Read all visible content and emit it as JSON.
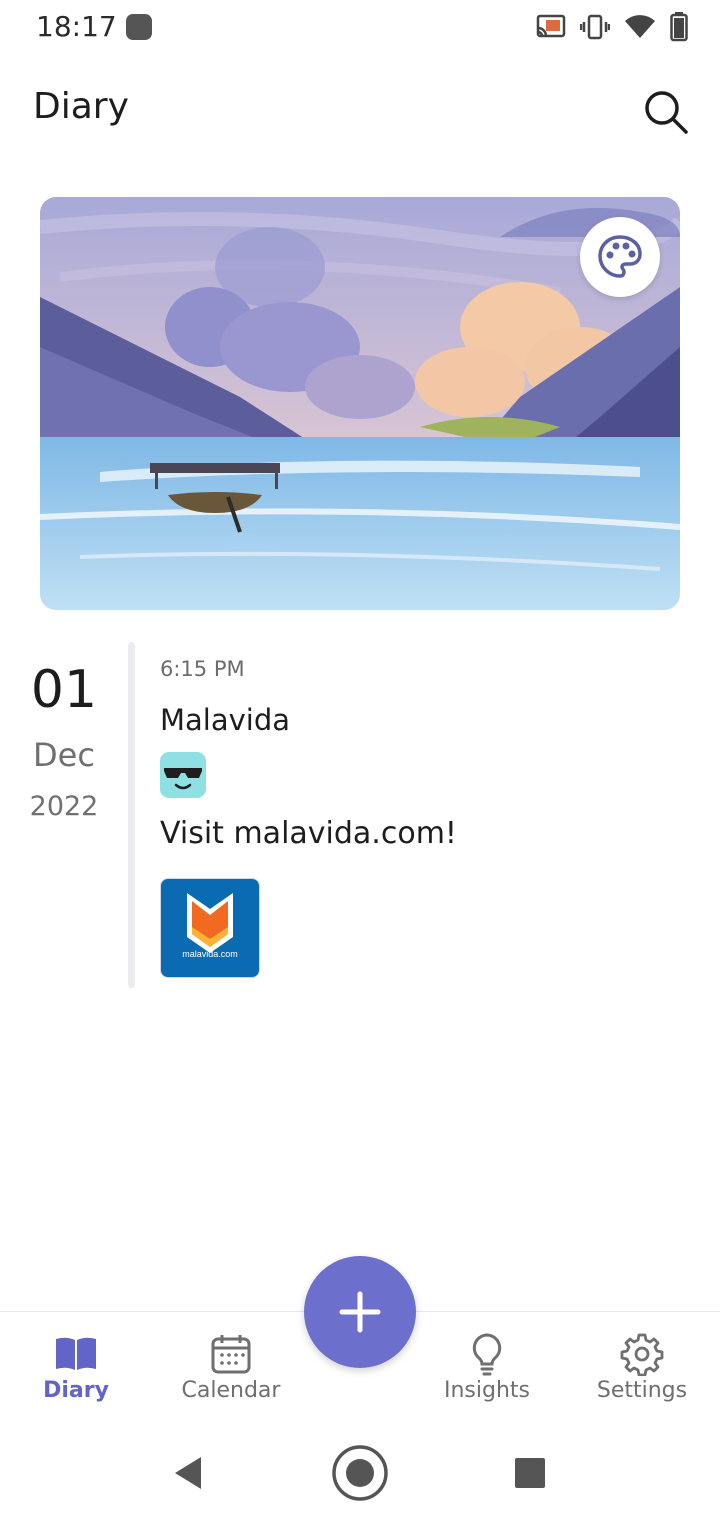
{
  "status_bar": {
    "time": "18:17",
    "icons": [
      "cast-icon",
      "vibrate-icon",
      "wifi-icon",
      "battery-icon"
    ]
  },
  "header": {
    "title": "Diary",
    "search_icon": "search-icon"
  },
  "cover": {
    "theme_icon": "palette-icon",
    "colors": {
      "sky": "#b4b3de",
      "water": "#8fc5ec",
      "mountain": "#5c5e9c"
    }
  },
  "entry": {
    "day": "01",
    "month": "Dec",
    "year": "2022",
    "time": "6:15 PM",
    "title": "Malavida",
    "mood_icon": "cool-sunglasses-face-icon",
    "body": "Visit malavida.com!",
    "attachment_caption": "malavida.com"
  },
  "fab": {
    "icon": "plus-icon",
    "color": "#6c70cc"
  },
  "bottom_nav": {
    "items": [
      {
        "label": "Diary",
        "icon": "book-icon",
        "active": true
      },
      {
        "label": "Calendar",
        "icon": "calendar-icon",
        "active": false
      },
      {
        "label": "Insights",
        "icon": "lightbulb-icon",
        "active": false
      },
      {
        "label": "Settings",
        "icon": "gear-icon",
        "active": false
      }
    ],
    "accent": "#6264c7"
  },
  "system_nav": {
    "buttons": [
      "back-icon",
      "home-icon",
      "recents-icon"
    ]
  }
}
